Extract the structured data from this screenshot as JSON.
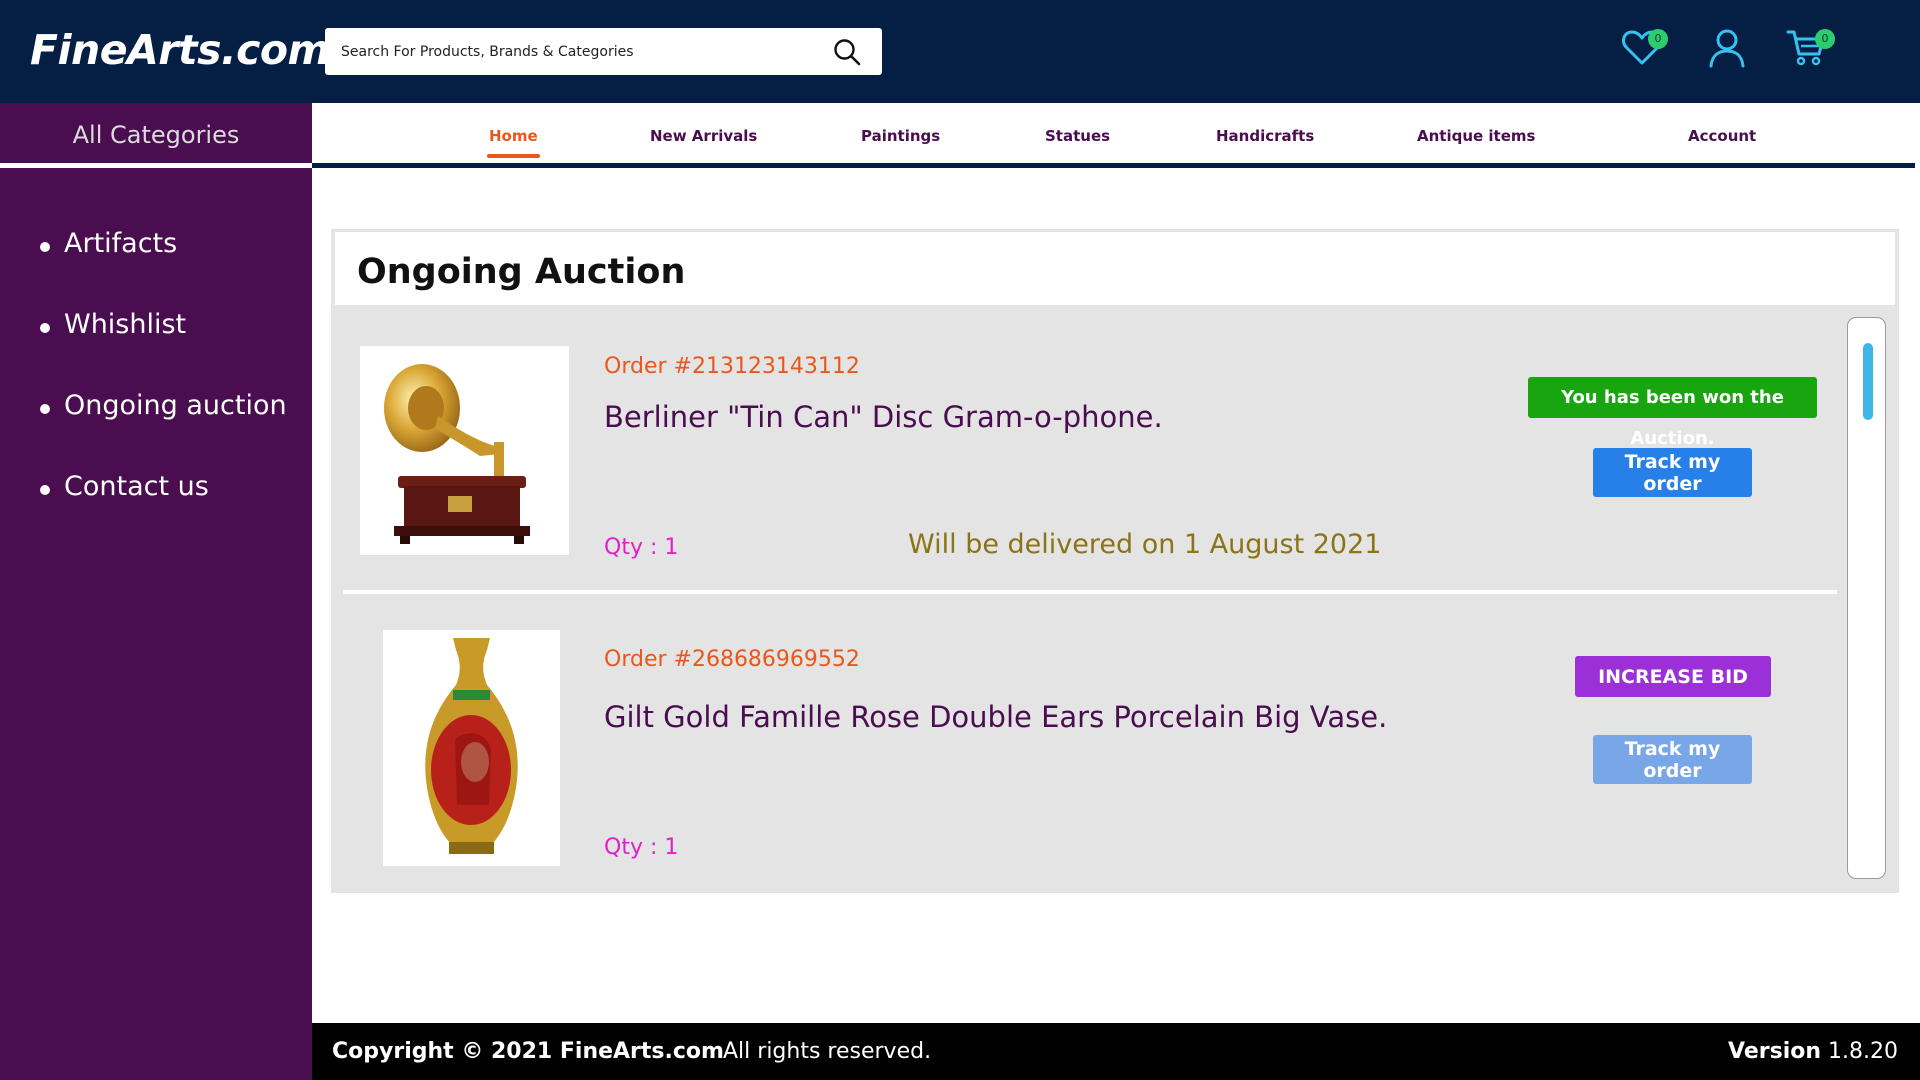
{
  "header": {
    "logo": "FineArts.com",
    "search_placeholder": "Search For Products, Brands & Categories",
    "wishlist_count": "0",
    "cart_count": "0"
  },
  "sidebar": {
    "all_categories": "All Categories",
    "items": [
      {
        "label": "Artifacts"
      },
      {
        "label": "Whishlist"
      },
      {
        "label": "Ongoing auction"
      },
      {
        "label": "Contact us"
      }
    ]
  },
  "nav": {
    "items": [
      {
        "label": "Home",
        "active": true
      },
      {
        "label": "New Arrivals"
      },
      {
        "label": "Paintings"
      },
      {
        "label": "Statues"
      },
      {
        "label": "Handicrafts"
      },
      {
        "label": "Antique items"
      },
      {
        "label": "Account"
      }
    ]
  },
  "main": {
    "title": "Ongoing Auction",
    "orders": [
      {
        "order_no": "Order #213123143112",
        "name": "Berliner \"Tin Can\" Disc Gram-o-phone.",
        "qty": "Qty : 1",
        "status_badge": "You has been won the Auction.",
        "delivery": "Will be delivered on 1 August 2021",
        "track_label": "Track my order"
      },
      {
        "order_no": "Order #268686969552",
        "name": "Gilt Gold Famille Rose Double Ears Porcelain Big Vase.",
        "qty": "Qty : 1",
        "bid_label": "INCREASE BID",
        "track_label": "Track my order"
      }
    ]
  },
  "footer": {
    "copyright": "Copyright  ©  2021  FineArts.com",
    "rights": "All rights reserved.",
    "version_label": "Version",
    "version": "1.8.20"
  },
  "colors": {
    "header_bg": "#041e44",
    "sidebar_bg": "#4a0d4f",
    "accent_orange": "#e8581b",
    "won_green": "#18a510",
    "track_blue": "#2680e8",
    "bid_purple": "#9b30d8",
    "badge_green": "#2ecc71"
  }
}
